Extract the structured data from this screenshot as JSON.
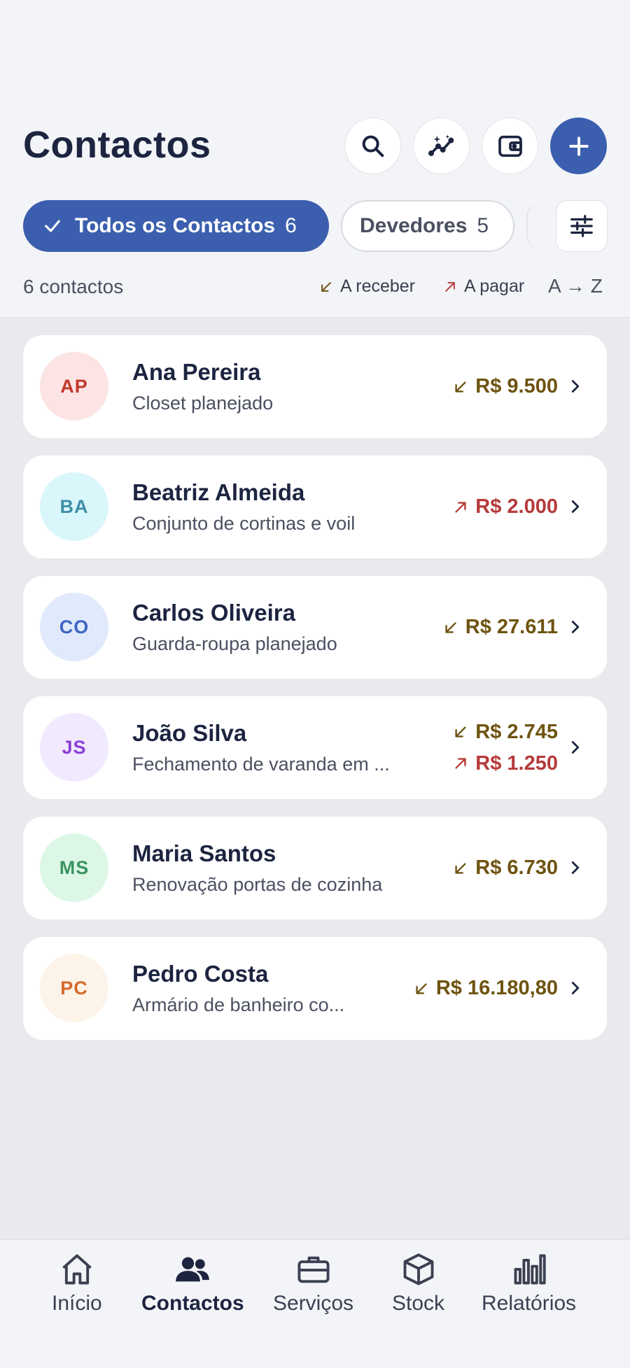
{
  "header": {
    "title": "Contactos"
  },
  "filters": {
    "all_label": "Todos os Contactos",
    "all_count": "6",
    "debtors_label": "Devedores",
    "debtors_count": "5"
  },
  "summary": {
    "count_text": "6 contactos",
    "legend_receive": "A receber",
    "legend_pay": "A pagar",
    "sort_label": "A → Z"
  },
  "contacts": [
    {
      "initials": "AP",
      "name": "Ana Pereira",
      "desc": "Closet planejado",
      "receive": "R$ 9.500",
      "pay": ""
    },
    {
      "initials": "BA",
      "name": "Beatriz Almeida",
      "desc": "Conjunto de cortinas e voil",
      "receive": "",
      "pay": "R$ 2.000"
    },
    {
      "initials": "CO",
      "name": "Carlos Oliveira",
      "desc": "Guarda-roupa planejado",
      "receive": "R$ 27.611",
      "pay": ""
    },
    {
      "initials": "JS",
      "name": "João Silva",
      "desc": "Fechamento de varanda em ...",
      "receive": "R$ 2.745",
      "pay": "R$ 1.250"
    },
    {
      "initials": "MS",
      "name": "Maria Santos",
      "desc": "Renovação portas de cozinha",
      "receive": "R$ 6.730",
      "pay": ""
    },
    {
      "initials": "PC",
      "name": "Pedro Costa",
      "desc": "Armário de banheiro co...",
      "receive": "R$ 16.180,80",
      "pay": ""
    }
  ],
  "nav": {
    "home": "Início",
    "contacts": "Contactos",
    "services": "Serviços",
    "stock": "Stock",
    "reports": "Relatórios"
  },
  "colors": {
    "primary": "#3b5fae",
    "receive": "#6e5310",
    "pay": "#b53a3a"
  }
}
